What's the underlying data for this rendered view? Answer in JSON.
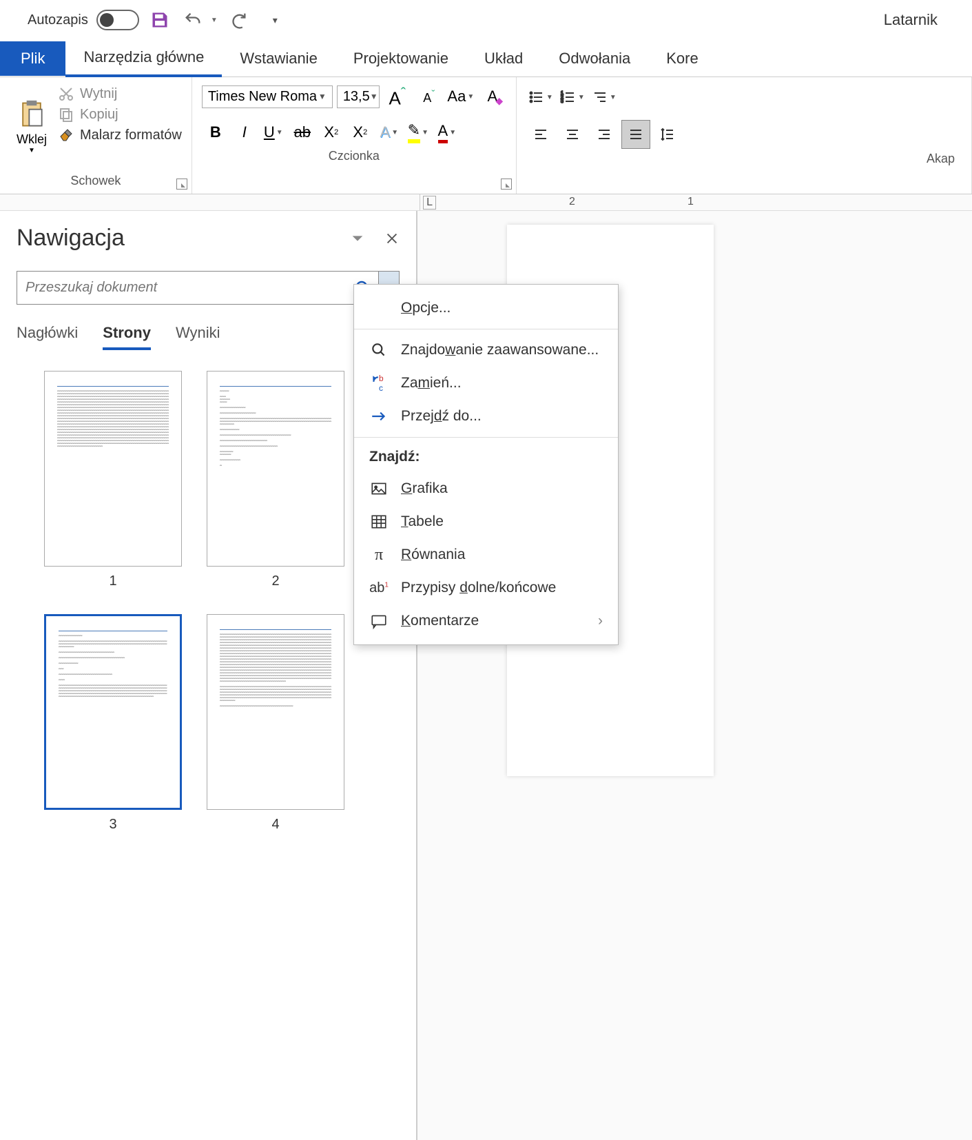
{
  "qat": {
    "autosave": "Autozapis",
    "doc_title": "Latarnik"
  },
  "tabs": {
    "file": "Plik",
    "home": "Narzędzia główne",
    "insert": "Wstawianie",
    "design": "Projektowanie",
    "layout": "Układ",
    "references": "Odwołania",
    "mail": "Kore"
  },
  "ribbon": {
    "clipboard": {
      "paste": "Wklej",
      "cut": "Wytnij",
      "copy": "Kopiuj",
      "format_painter": "Malarz formatów",
      "group": "Schowek"
    },
    "font": {
      "name": "Times New Roma",
      "size": "13,5",
      "group": "Czcionka"
    },
    "paragraph": {
      "group": "Akap"
    }
  },
  "nav": {
    "title": "Nawigacja",
    "search_placeholder": "Przeszukaj dokument",
    "tabs": {
      "headings": "Nagłówki",
      "pages": "Strony",
      "results": "Wyniki"
    },
    "pages": [
      "1",
      "2",
      "3",
      "4"
    ]
  },
  "menu": {
    "options": "Opcje...",
    "advanced_find": "Znajdowanie zaawansowane...",
    "replace": "Zamień...",
    "goto": "Przejdź do...",
    "find_section": "Znajdź:",
    "graphics": "Grafika",
    "tables": "Tabele",
    "equations": "Równania",
    "footnotes": "Przypisy dolne/końcowe",
    "comments": "Komentarze"
  },
  "ruler": {
    "m1": "2",
    "m2": "1"
  }
}
